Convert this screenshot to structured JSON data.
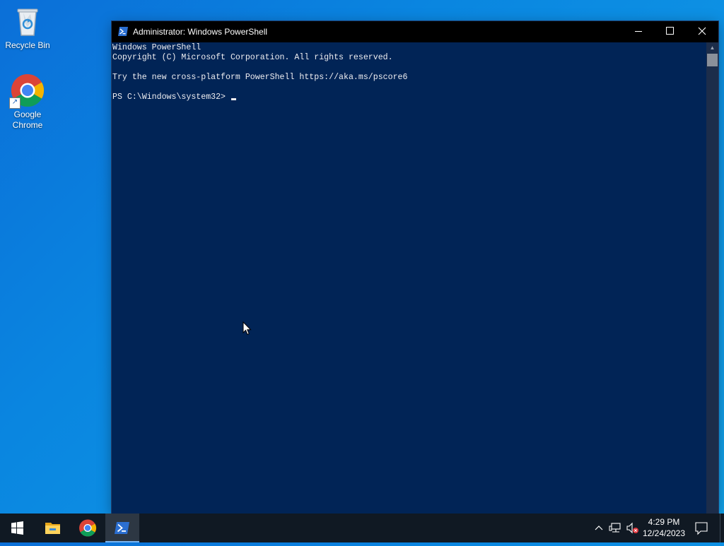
{
  "desktop": {
    "icons": [
      {
        "label": "Recycle Bin",
        "icon": "recycle-bin-icon"
      },
      {
        "label": "Google\nChrome",
        "icon": "chrome-icon"
      }
    ]
  },
  "window": {
    "title": "Administrator: Windows PowerShell",
    "icon": "powershell-icon",
    "buttons": {
      "minimize": "minimize-icon",
      "maximize": "maximize-icon",
      "close": "close-icon"
    },
    "console_lines": [
      "Windows PowerShell",
      "Copyright (C) Microsoft Corporation. All rights reserved.",
      "",
      "Try the new cross-platform PowerShell https://aka.ms/pscore6",
      "",
      "PS C:\\Windows\\system32> "
    ],
    "colors": {
      "background": "#012456",
      "text": "#eeedf0",
      "titlebar": "#000000"
    }
  },
  "taskbar": {
    "pinned": [
      {
        "name": "start",
        "icon": "windows-logo-icon"
      },
      {
        "name": "file-explorer",
        "icon": "folder-icon"
      },
      {
        "name": "chrome",
        "icon": "chrome-icon"
      },
      {
        "name": "powershell",
        "icon": "powershell-icon",
        "active": true
      }
    ],
    "tray": {
      "icons": [
        "chevron-up-icon",
        "network-icon",
        "volume-muted-icon"
      ],
      "time": "4:29 PM",
      "date": "12/24/2023",
      "notification_icon": "notification-icon"
    }
  }
}
